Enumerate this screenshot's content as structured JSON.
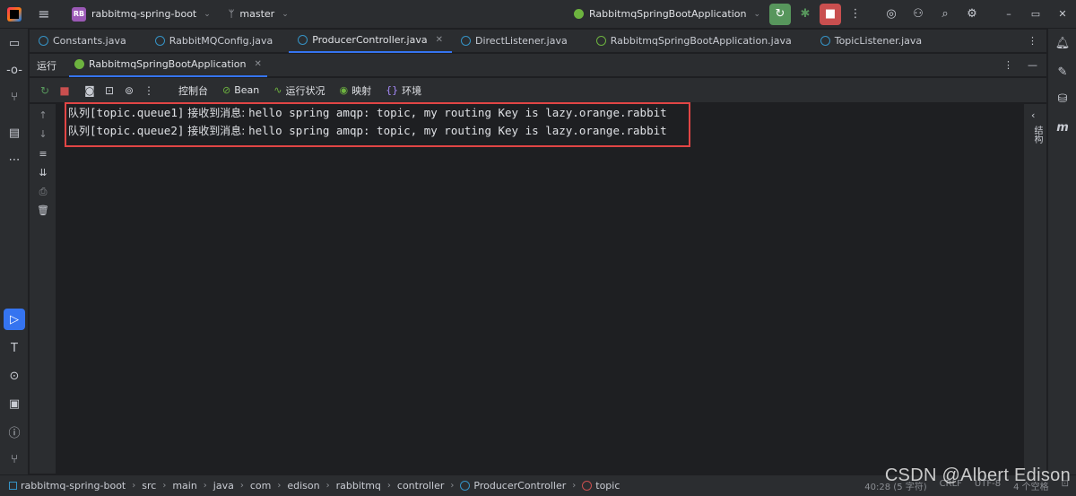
{
  "titlebar": {
    "project_badge": "RB",
    "project_name": "rabbitmq-spring-boot",
    "branch": "master",
    "run_config": "RabbitmqSpringBootApplication"
  },
  "editor_tabs": [
    {
      "label": "Constants.java",
      "icon": "class-icon"
    },
    {
      "label": "RabbitMQConfig.java",
      "icon": "class-icon"
    },
    {
      "label": "ProducerController.java",
      "icon": "class-icon",
      "active": true,
      "closable": true
    },
    {
      "label": "DirectListener.java",
      "icon": "class-icon"
    },
    {
      "label": "RabbitmqSpringBootApplication.java",
      "icon": "spring-class-icon"
    },
    {
      "label": "TopicListener.java",
      "icon": "class-icon"
    }
  ],
  "run_panel": {
    "title": "运行",
    "tab_label": "RabbitmqSpringBootApplication"
  },
  "run_toolbar": {
    "tabs": [
      {
        "label": "控制台",
        "icon": "console-icon"
      },
      {
        "label": "Bean",
        "icon": "bean-icon"
      },
      {
        "label": "运行状况",
        "icon": "health-icon"
      },
      {
        "label": "映射",
        "icon": "mapping-icon"
      },
      {
        "label": "环境",
        "icon": "env-icon"
      }
    ]
  },
  "console": {
    "lines": [
      {
        "prefix": "队列",
        "queue": "[topic.queue1]",
        "label": " 接收到消息: ",
        "message": "hello spring amqp: topic, my routing Key is lazy.orange.rabbit"
      },
      {
        "prefix": "队列",
        "queue": "[topic.queue2]",
        "label": " 接收到消息: ",
        "message": "hello spring amqp: topic, my routing Key is lazy.orange.rabbit"
      }
    ],
    "highlight_color": "#e14545"
  },
  "console_side_label": "结构",
  "statusbar": {
    "breadcrumbs": [
      "rabbitmq-spring-boot",
      "src",
      "main",
      "java",
      "com",
      "edison",
      "rabbitmq",
      "controller",
      "ProducerController",
      "topic"
    ],
    "position": "40:28 (5 字符)",
    "line_sep": "CRLF",
    "encoding": "UTF-8",
    "indent": "4 个空格"
  },
  "watermark": "CSDN @Albert Edison",
  "colors": {
    "accent": "#3574f0",
    "run_green": "#57965c",
    "stop_red": "#c94f4f",
    "background": "#1e1f22",
    "panel": "#2b2d30"
  }
}
